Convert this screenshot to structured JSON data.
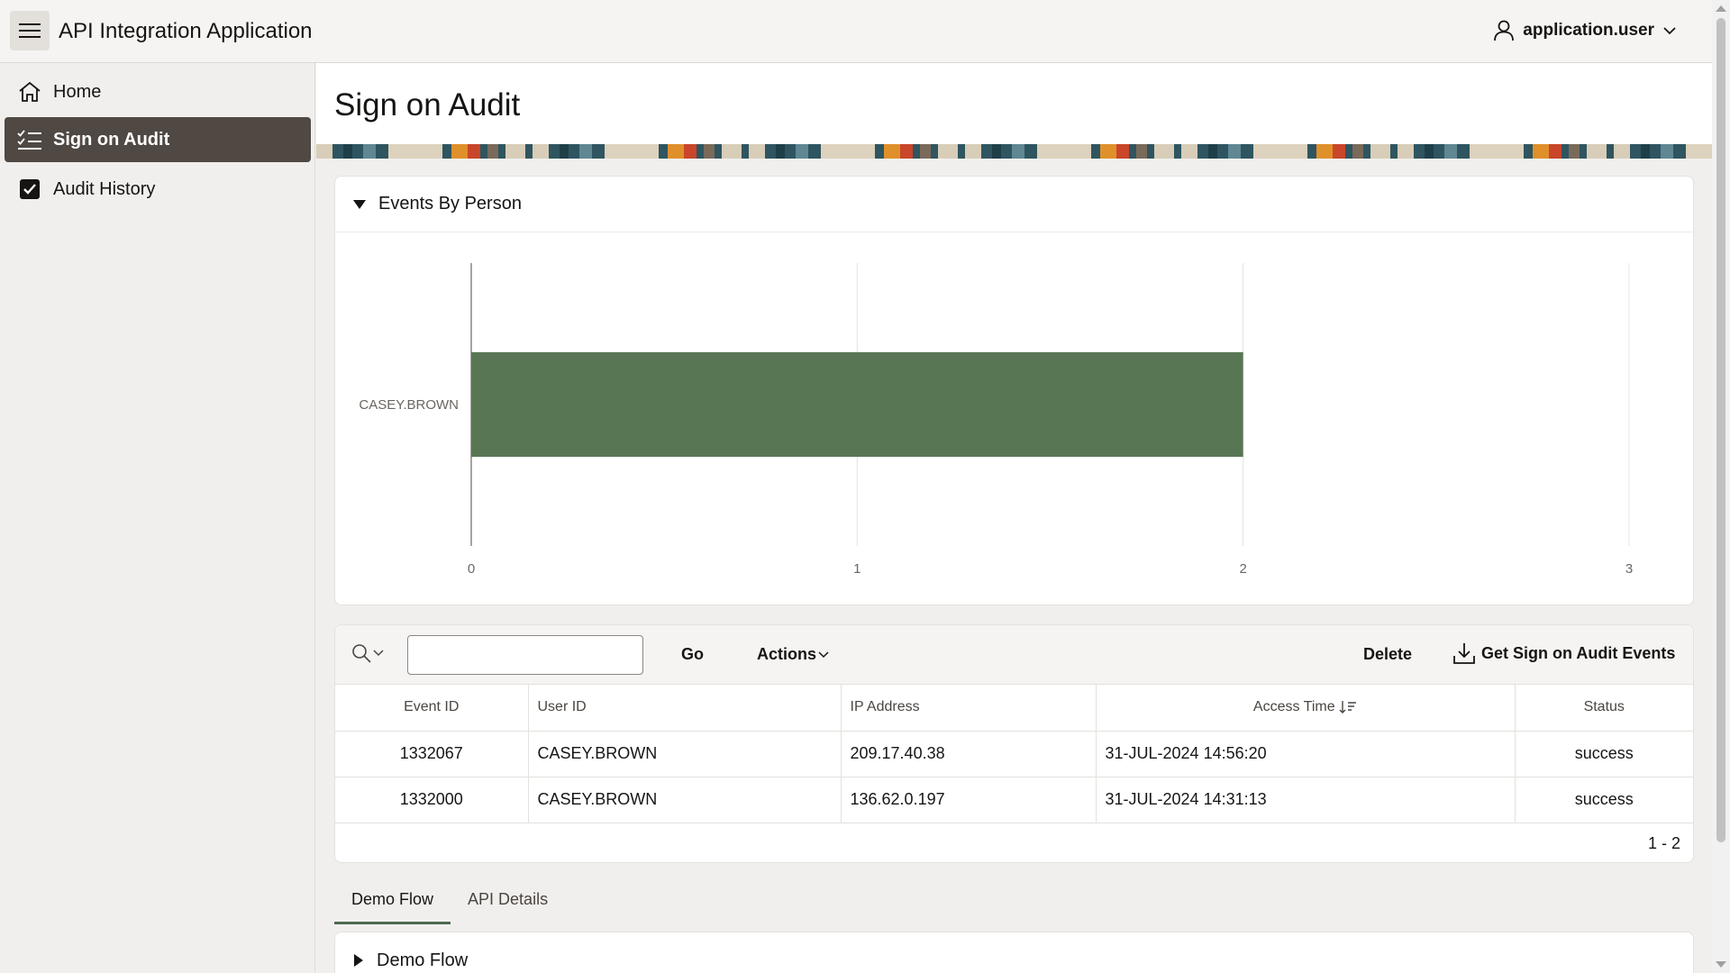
{
  "header": {
    "app_title": "API Integration Application",
    "user_name": "application.user"
  },
  "sidebar": {
    "items": [
      {
        "label": "Home",
        "icon": "home-icon"
      },
      {
        "label": "Sign on Audit",
        "icon": "checklist-icon",
        "active": true
      },
      {
        "label": "Audit History",
        "icon": "checkbox-icon"
      }
    ]
  },
  "page": {
    "title": "Sign on Audit"
  },
  "chart_region": {
    "title": "Events By Person"
  },
  "chart_data": {
    "type": "bar",
    "orientation": "horizontal",
    "categories": [
      "CASEY.BROWN"
    ],
    "values": [
      2
    ],
    "xlim": [
      0,
      3
    ],
    "xticks": [
      "0",
      "1",
      "2",
      "3"
    ],
    "grid": true,
    "bar_color": "#587654"
  },
  "report": {
    "search_placeholder": "",
    "go_label": "Go",
    "actions_label": "Actions",
    "delete_label": "Delete",
    "get_events_label": "Get Sign on Audit Events",
    "columns": [
      "Event ID",
      "User ID",
      "IP Address",
      "Access Time",
      "Status"
    ],
    "rows": [
      {
        "event_id": "1332067",
        "user_id": "CASEY.BROWN",
        "ip": "209.17.40.38",
        "time": "31-JUL-2024 14:56:20",
        "status": "success"
      },
      {
        "event_id": "1332000",
        "user_id": "CASEY.BROWN",
        "ip": "136.62.0.197",
        "time": "31-JUL-2024 14:31:13",
        "status": "success"
      }
    ],
    "pagination": "1 - 2"
  },
  "tabs": [
    {
      "label": "Demo Flow",
      "active": true
    },
    {
      "label": "API Details"
    }
  ],
  "demo_region": {
    "title": "Demo Flow"
  },
  "colors": {
    "accent": "#4c6a4f",
    "sidebar_active": "#4f4843"
  }
}
